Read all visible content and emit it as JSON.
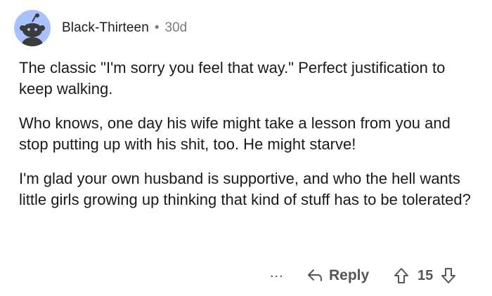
{
  "comment": {
    "author": "Black-Thirteen",
    "separator": "•",
    "age": "30d",
    "paragraphs": [
      "The classic \"I'm sorry you feel that way.\" Perfect justification to keep walking.",
      "Who knows, one day his wife might take a lesson from you and stop putting up with his shit, too. He might starve!",
      "I'm glad your own husband is supportive, and who the hell wants little girls growing up thinking that kind of stuff has to be tolerated?"
    ],
    "actions": {
      "more_label": "...",
      "reply_label": "Reply",
      "score": "15"
    }
  },
  "colors": {
    "avatar_bg": "#a9c1ff",
    "avatar_figure": "#3b3b3b",
    "meta_text": "#7c7c7c",
    "action_text": "#555555"
  },
  "icons": [
    "reddit-snoo-avatar-icon",
    "reply-arrow-icon",
    "upvote-arrow-icon",
    "downvote-arrow-icon"
  ]
}
